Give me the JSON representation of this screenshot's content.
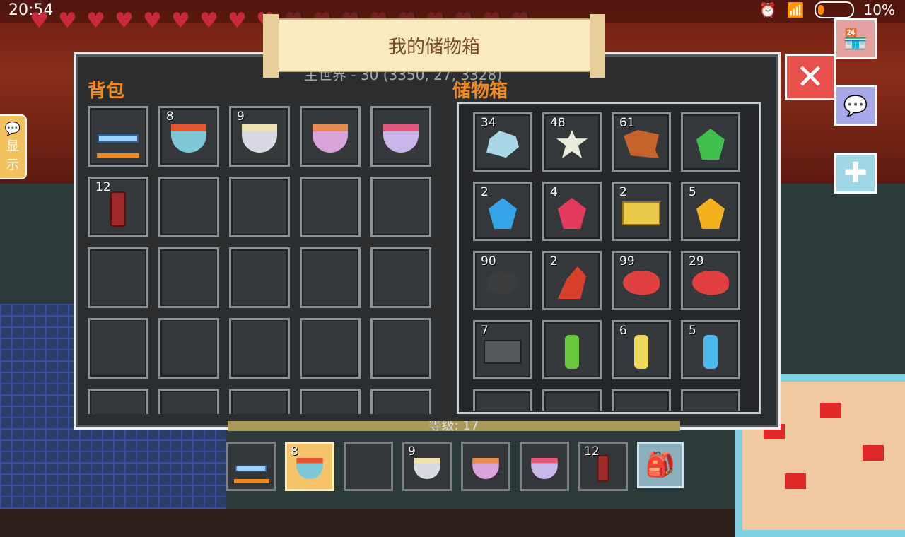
{
  "status": {
    "time": "20:54",
    "battery": "10%"
  },
  "player": {
    "hearts_full": 9,
    "hearts_empty": 9
  },
  "panel": {
    "title": "我的储物箱",
    "subtitle": "主世界 - 30 (3350, 27, 3328)",
    "bag_title": "背包",
    "chest_title": "储物箱",
    "level_label": "等级: 17"
  },
  "side_tab": {
    "char1": "显",
    "char2": "示"
  },
  "bag": {
    "slots": [
      {
        "item": "sword",
        "count": "",
        "durability": 0.8
      },
      {
        "item": "bowl-blue",
        "count": "8"
      },
      {
        "item": "bowl-white",
        "count": "9"
      },
      {
        "item": "bowl-pink",
        "count": ""
      },
      {
        "item": "bowl-lilac",
        "count": ""
      },
      {
        "item": "bottle",
        "count": "12"
      },
      {},
      {},
      {},
      {},
      {},
      {},
      {},
      {},
      {},
      {},
      {},
      {},
      {},
      {},
      {},
      {},
      {},
      {},
      {}
    ]
  },
  "chest": {
    "slots": [
      {
        "item": "rock",
        "count": "34"
      },
      {
        "item": "flower",
        "count": "48"
      },
      {
        "item": "leather",
        "count": "61"
      },
      {
        "item": "gem-green",
        "count": ""
      },
      {
        "item": "gem-blue",
        "count": "2"
      },
      {
        "item": "gem-red",
        "count": "4"
      },
      {
        "item": "ingot",
        "count": "2"
      },
      {
        "item": "gem-gold",
        "count": "5"
      },
      {
        "item": "coal",
        "count": "90"
      },
      {
        "item": "wing",
        "count": "2"
      },
      {
        "item": "blob",
        "count": "99"
      },
      {
        "item": "blob",
        "count": "29"
      },
      {
        "item": "ingot-dark",
        "count": "7"
      },
      {
        "item": "scroll-green",
        "count": ""
      },
      {
        "item": "scroll-yellow",
        "count": "6"
      },
      {
        "item": "scroll-blue",
        "count": "5"
      },
      {},
      {},
      {},
      {}
    ]
  },
  "hotbar": {
    "slots": [
      {
        "item": "sword",
        "count": "",
        "durability": 0.8
      },
      {
        "item": "bowl-blue",
        "count": "8",
        "selected": true
      },
      {},
      {
        "item": "bowl-white",
        "count": "9"
      },
      {
        "item": "bowl-pink",
        "count": ""
      },
      {
        "item": "bowl-lilac",
        "count": ""
      },
      {
        "item": "bottle",
        "count": "12"
      }
    ]
  },
  "icons": {
    "close": "close-icon",
    "shop": "shop-icon",
    "chat": "chat-icon",
    "plus": "plus-icon",
    "backpack": "backpack-icon"
  },
  "colors": {
    "section_title": "#f08a1e",
    "close": "#e8504c",
    "selected_slot": "#f4c36a"
  }
}
